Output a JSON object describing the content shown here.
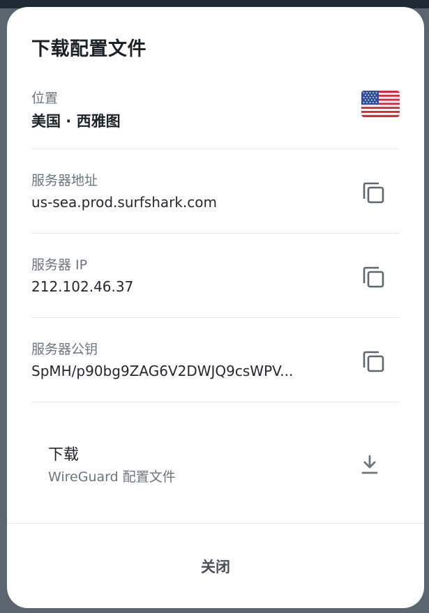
{
  "dialog": {
    "title": "下载配置文件",
    "location": {
      "label": "位置",
      "value": "美国 · 西雅图",
      "flag_icon": "us-flag-icon"
    },
    "server_address": {
      "label": "服务器地址",
      "value": "us-sea.prod.surfshark.com",
      "icon": "copy-icon"
    },
    "server_ip": {
      "label": "服务器 IP",
      "value": "212.102.46.37",
      "icon": "copy-icon"
    },
    "public_key": {
      "label": "服务器公钥",
      "value": "SpMH/p90bg9ZAG6V2DWJQ9csWPV...",
      "icon": "copy-icon"
    },
    "download": {
      "title": "下载",
      "subtitle": "WireGuard 配置文件",
      "icon": "download-icon"
    },
    "close_label": "关闭"
  },
  "colors": {
    "background": "#5b6570",
    "dialog": "#ffffff",
    "text_primary": "#1e2126",
    "text_secondary": "#6d747c",
    "icon": "#5f666e",
    "divider": "#e6e8ea"
  }
}
